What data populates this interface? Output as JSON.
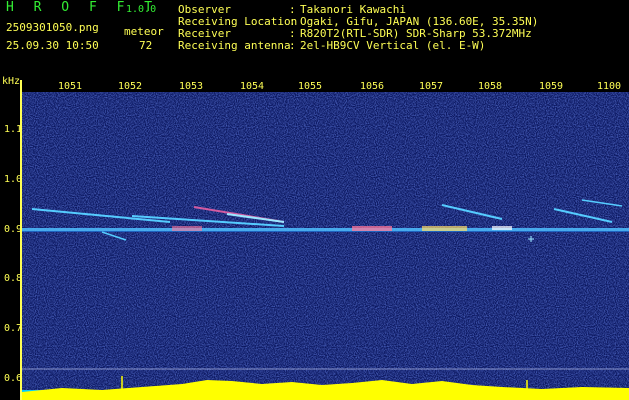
{
  "header": {
    "brand": "H R O F F T",
    "version": "1.0.0",
    "filename": "2509301050.png",
    "datetime": "25.09.30 10:50",
    "meteor_label": "meteor",
    "meteor_count": "72",
    "fields": [
      {
        "label": "Observer",
        "value": "Takanori Kawachi"
      },
      {
        "label": "Receiving Location",
        "value": "Ogaki, Gifu, JAPAN (136.60E, 35.35N)"
      },
      {
        "label": "Receiver",
        "value": "R820T2(RTL-SDR) SDR-Sharp 53.372MHz"
      },
      {
        "label": "Receiving antenna",
        "value": "2el-HB9CV Vertical (el. E-W)"
      }
    ],
    "separator": ":"
  },
  "axes": {
    "y_unit": "kHz",
    "y_ticks": [
      "1.1",
      "1.0",
      "0.9",
      "0.8",
      "0.7",
      "0.6"
    ],
    "x_ticks": [
      "1051",
      "1052",
      "1053",
      "1054",
      "1055",
      "1056",
      "1057",
      "1058",
      "1059",
      "1100"
    ]
  },
  "colors": {
    "text": "#ffff55",
    "brand": "#33ee33",
    "background": "#0b1760",
    "trace": "#55ccff",
    "signal_bar": "#ffff00",
    "baseline": "#00ccff"
  }
}
